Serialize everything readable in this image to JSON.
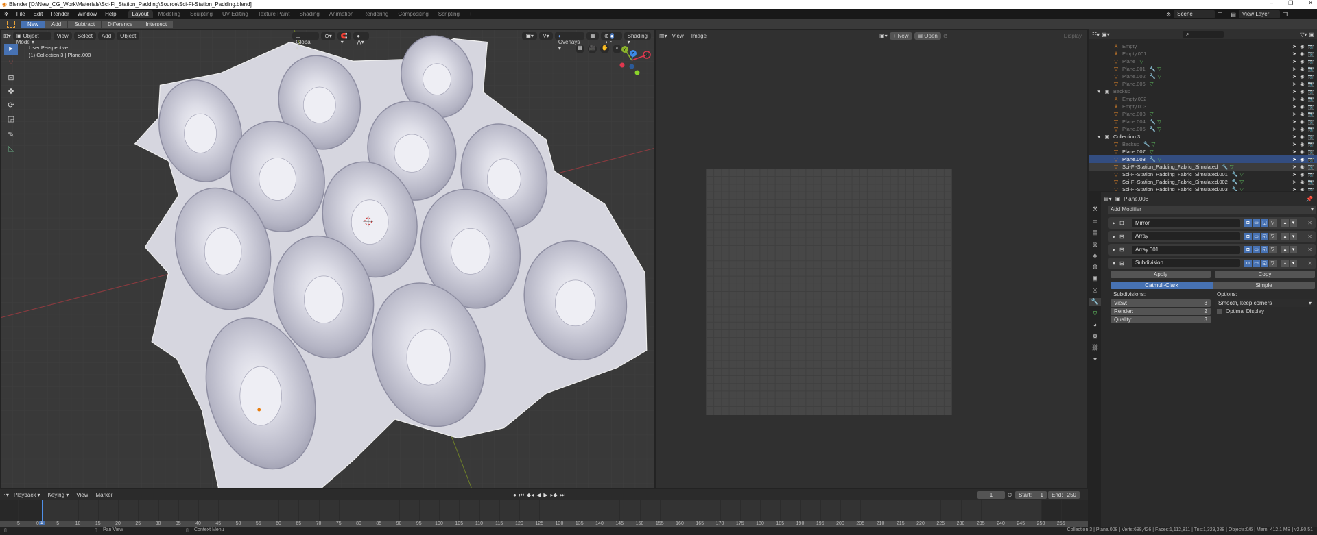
{
  "window": {
    "title": "Blender [D:\\New_CG_Work\\Materials\\Sci-Fi_Station_Padding\\Source\\Sci-Fi-Station_Padding.blend]",
    "controls": [
      "–",
      "❐",
      "✕"
    ]
  },
  "menus": [
    "File",
    "Edit",
    "Render",
    "Window",
    "Help"
  ],
  "workspaces": [
    "Layout",
    "Modeling",
    "Sculpting",
    "UV Editing",
    "Texture Paint",
    "Shading",
    "Animation",
    "Rendering",
    "Compositing",
    "Scripting",
    "+"
  ],
  "active_workspace": "Layout",
  "scene": {
    "scene_name": "Scene",
    "view_layer": "View Layer"
  },
  "tool_settings": {
    "modes": [
      "New",
      "Add",
      "Subtract",
      "Difference",
      "Intersect"
    ],
    "active": "New"
  },
  "viewport": {
    "mode": "Object Mode",
    "menus": [
      "View",
      "Select",
      "Add",
      "Object"
    ],
    "orientation": "Global",
    "overlays": "Overlays",
    "shading": "Shading",
    "info_line1": "User Perspective",
    "info_line2": "(1) Collection 3 | Plane.008",
    "gizmo": {
      "x": "X",
      "y": "Y",
      "z": "Z"
    },
    "colors": {
      "x": "#e0374e",
      "y": "#8bb42b",
      "z": "#3d8ae6"
    }
  },
  "image_editor": {
    "menus": [
      "View",
      "Image"
    ],
    "new_label": "New",
    "open_label": "Open",
    "display_label": "Display"
  },
  "outliner": {
    "items": [
      {
        "name": "Empty",
        "type": "empty",
        "depth": 2,
        "dim": true,
        "mod": false
      },
      {
        "name": "Empty.001",
        "type": "empty",
        "depth": 2,
        "dim": true,
        "mod": false
      },
      {
        "name": "Plane",
        "type": "mesh",
        "depth": 2,
        "dim": true,
        "mod": false
      },
      {
        "name": "Plane.001",
        "type": "mesh",
        "depth": 2,
        "dim": true,
        "mod": true
      },
      {
        "name": "Plane.002",
        "type": "mesh",
        "depth": 2,
        "dim": true,
        "mod": true
      },
      {
        "name": "Plane.006",
        "type": "mesh",
        "depth": 2,
        "dim": true,
        "mod": false
      },
      {
        "name": "Backup",
        "type": "collection",
        "depth": 1,
        "dim": true,
        "mod": false
      },
      {
        "name": "Empty.002",
        "type": "empty",
        "depth": 2,
        "dim": true,
        "mod": false
      },
      {
        "name": "Empty.003",
        "type": "empty",
        "depth": 2,
        "dim": true,
        "mod": false
      },
      {
        "name": "Plane.003",
        "type": "mesh",
        "depth": 2,
        "dim": true,
        "mod": false
      },
      {
        "name": "Plane.004",
        "type": "mesh",
        "depth": 2,
        "dim": true,
        "mod": true
      },
      {
        "name": "Plane.005",
        "type": "mesh",
        "depth": 2,
        "dim": true,
        "mod": true
      },
      {
        "name": "Collection 3",
        "type": "collection",
        "depth": 1,
        "dim": false,
        "mod": false
      },
      {
        "name": "Backup",
        "type": "mesh",
        "depth": 2,
        "dim": true,
        "mod": true
      },
      {
        "name": "Plane.007",
        "type": "mesh",
        "depth": 2,
        "dim": false,
        "mod": false
      },
      {
        "name": "Plane.008",
        "type": "mesh",
        "depth": 2,
        "dim": false,
        "mod": true,
        "selected": true
      },
      {
        "name": "Sci-Fi-Station_Padding_Fabric_Simulated",
        "type": "mesh",
        "depth": 2,
        "dim": false,
        "mod": true,
        "highlight": true
      },
      {
        "name": "Sci-Fi-Station_Padding_Fabric_Simulated.001",
        "type": "mesh",
        "depth": 2,
        "dim": false,
        "mod": true
      },
      {
        "name": "Sci-Fi-Station_Padding_Fabric_Simulated.002",
        "type": "mesh",
        "depth": 2,
        "dim": false,
        "mod": true
      },
      {
        "name": "Sci-Fi-Station_Padding_Fabric_Simulated.003",
        "type": "mesh",
        "depth": 2,
        "dim": false,
        "mod": true
      }
    ]
  },
  "properties": {
    "object": "Plane.008",
    "add_modifier": "Add Modifier",
    "modifiers": [
      {
        "name": "Mirror",
        "expanded": false
      },
      {
        "name": "Array",
        "expanded": false
      },
      {
        "name": "Array.001",
        "expanded": false
      },
      {
        "name": "Subdivision",
        "expanded": true
      }
    ],
    "apply": "Apply",
    "copy": "Copy",
    "algorithms": [
      "Catmull-Clark",
      "Simple"
    ],
    "active_algorithm": "Catmull-Clark",
    "subdivisions_label": "Subdivisions:",
    "view_label": "View:",
    "view_value": "3",
    "render_label": "Render:",
    "render_value": "2",
    "quality_label": "Quality:",
    "quality_value": "3",
    "options_label": "Options:",
    "uv_smooth": "Smooth, keep corners",
    "optimal_display": "Optimal Display",
    "optimal_display_checked": false
  },
  "timeline": {
    "menus": [
      "Playback",
      "Keying",
      "View",
      "Marker"
    ],
    "current_frame": "1",
    "start_label": "Start:",
    "start": "1",
    "end_label": "End:",
    "end": "250",
    "ruler_first": -5,
    "ruler_last": 255,
    "ruler_step": 5,
    "playhead_label": "1"
  },
  "statusbar": {
    "hint1": "Pan View",
    "hint2": "Context Menu",
    "stats": "Collection 3 | Plane.008 | Verts:688,426 | Faces:1,112,811 | Tris:1,329,388 | Objects:0/6 | Mem: 412.1 MB | v2.80.51"
  }
}
